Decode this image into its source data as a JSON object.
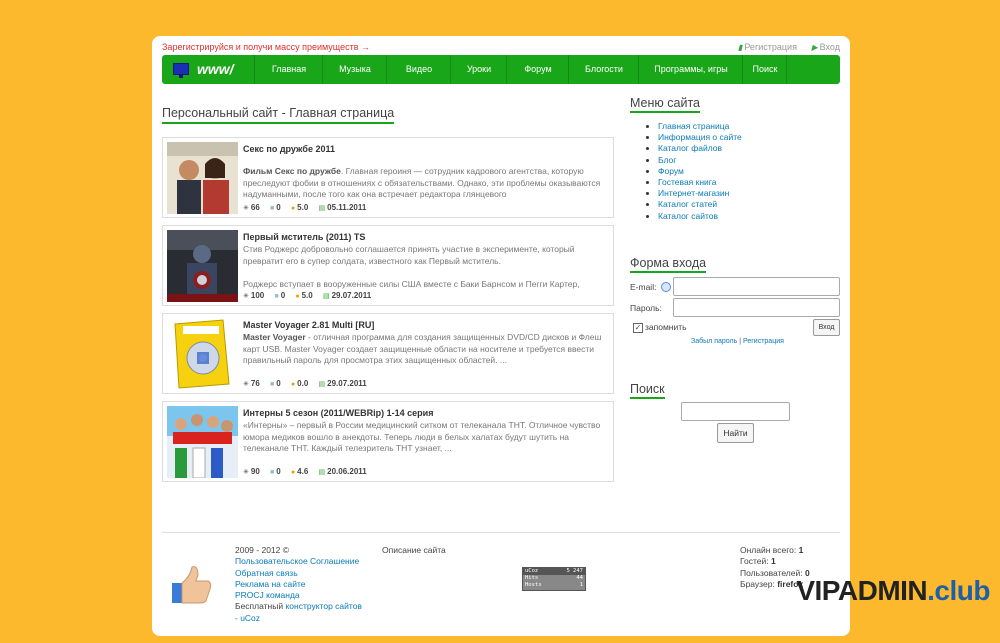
{
  "topbar": {
    "promo": "Зарегистрируйся и получи массу преимуществ →",
    "register": "Регистрация",
    "login": "Вход"
  },
  "nav": {
    "logo": "www/",
    "items": [
      "Главная",
      "Музыка",
      "Видео",
      "Уроки",
      "Форум",
      "Блогости",
      "Программы, игры",
      "Поиск"
    ]
  },
  "main": {
    "heading": "Персональный сайт - Главная страница",
    "entries": [
      {
        "title": "Секс по дружбе 2011",
        "lead": "Фильм Секс по дружбе",
        "desc": ". Главная героиня — сотрудник кадрового агентства, которую преследуют фобии в отношениях с обязательствами. Однако, эти проблемы оказываются надуманными, после того как она встречает редактора глянцевого",
        "views": "66",
        "comments": "0",
        "rating": "5.0",
        "date": "05.11.2011"
      },
      {
        "title": "Первый мститель (2011) TS",
        "lead": "",
        "desc": "Стив Роджерс добровольно соглашается принять участие в эксперименте, который превратит его в супер солдата, известного как Первый мститель.",
        "desc2": "Роджерс вступает в вооруженные силы США вместе с Баки Барнсом и Пегги Картер,",
        "views": "100",
        "comments": "0",
        "rating": "5.0",
        "date": "29.07.2011"
      },
      {
        "title": "Master Voyager 2.81 Multi [RU]",
        "lead": "Master Voyager",
        "desc": " - отличная программа для создания защищенных DVD/CD дисков и Флеш карт USB. Master Voyager создает защищенные области на носителе и требуется ввести правильный пароль для просмотра этих защищенных областей.  ...",
        "views": "76",
        "comments": "0",
        "rating": "0.0",
        "date": "29.07.2011"
      },
      {
        "title": "Интерны 5 сезон (2011/WEBRip) 1-14 серия",
        "lead": "",
        "desc": "«Интерны» – первый в России медицинский ситком от телеканала ТНТ. Отличное чувство юмора медиков вошло в анекдоты. Теперь люди в белых халатах будут шутить на телеканале ТНТ. Каждый телезритель ТНТ узнает, ...",
        "views": "90",
        "comments": "0",
        "rating": "4.6",
        "date": "20.06.2011"
      }
    ]
  },
  "sidebar": {
    "menu_title": "Меню сайта",
    "menu": [
      "Главная страница",
      "Информация о сайте",
      "Каталог файлов",
      "Блог",
      "Форум",
      "Гостевая книга",
      "Интернет-магазин",
      "Каталог статей",
      "Каталог сайтов"
    ],
    "login_title": "Форма входа",
    "email_label": "E-mail:",
    "password_label": "Пароль:",
    "remember_label": "запомнить",
    "login_button": "Вход",
    "forgot_link": "Забыл пароль",
    "sep": "|",
    "register_link": "Регистрация",
    "search_title": "Поиск",
    "search_button": "Найти"
  },
  "footer": {
    "copyright": "2009 - 2012 ©",
    "links": [
      "Пользовательское Соглашение",
      "Обратная связь",
      "Реклама на сайте",
      "PROCJ команда"
    ],
    "free_text": "Бесплатный",
    "builder_link": "конструктор сайтов",
    "ucoz_link": "- uCoz",
    "site_description": "Описание сайта",
    "counter": {
      "brand": "uCoz",
      "r1": "5 247",
      "hits_label": "Hits",
      "hits": "44",
      "hosts_label": "Hosts",
      "hosts": "1"
    },
    "stats": [
      {
        "label": "Онлайн всего:",
        "value": "1"
      },
      {
        "label": "Гостей:",
        "value": "1"
      },
      {
        "label": "Пользователей:",
        "value": "0"
      },
      {
        "label": "Браузер:",
        "value": "firefox"
      }
    ]
  },
  "watermark": {
    "main": "VIPADMIN",
    "suffix": ".club"
  },
  "colors": {
    "background": "#fdb92e",
    "nav": "#1aa619",
    "link": "#0a7ab8",
    "promo": "#e03030"
  }
}
